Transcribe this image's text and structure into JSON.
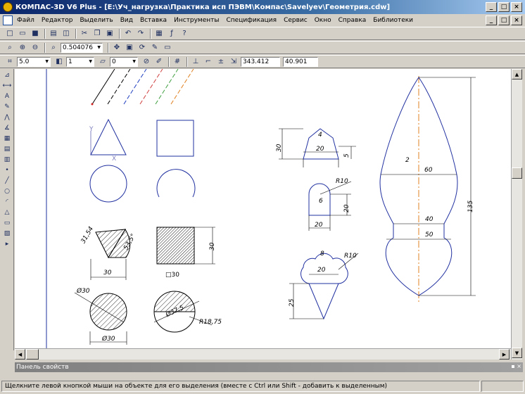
{
  "window": {
    "title": "КОМПАС-3D V6 Plus - [E:\\Уч_нагрузка\\Практика исп ПЭВМ\\Компас\\Savelyev\\Геометрия.cdw]",
    "minimize": "_",
    "maximize": "□",
    "close": "×"
  },
  "menu": {
    "items": [
      "Файл",
      "Редактор",
      "Выделить",
      "Вид",
      "Вставка",
      "Инструменты",
      "Спецификация",
      "Сервис",
      "Окно",
      "Справка",
      "Библиотеки"
    ]
  },
  "toolbar2": {
    "zoom_value": "0.504076"
  },
  "toolbar3": {
    "step_value": "5.0",
    "layer_value": "1",
    "style_value": "0",
    "coord_x": "343.412",
    "coord_y": "40.901"
  },
  "drawing": {
    "dim_label_2": "2",
    "dim_30_a": "30",
    "dim_20_a": "20",
    "dim_5": "5",
    "label_4": "4",
    "dim_60": "60",
    "dim_40": "40",
    "dim_50": "50",
    "dim_135": "135",
    "dim_r10": "R10",
    "label_6": "6",
    "dim_20_b": "20",
    "dim_20_c": "20",
    "dim_3154": "31,54",
    "dim_angle": "53,5°",
    "dim_30_b": "30",
    "dim_30_c": "30",
    "dim_box30": "□30",
    "dim_d30_a": "Ø30",
    "dim_d30_b": "Ø30",
    "dim_d375": "Ø37,5",
    "dim_r1875": "R18,75",
    "label_8": "8",
    "dim_r10_b": "R10",
    "dim_20_d": "20",
    "dim_25": "25",
    "axis_y": "Y",
    "axis_x": "X"
  },
  "property_panel": {
    "title": "Панель свойств",
    "controls": "▪ ×"
  },
  "status": {
    "hint": "Щелкните левой кнопкой мыши на объекте для его выделения (вместе с Ctrl или Shift - добавить к выделенным)"
  }
}
